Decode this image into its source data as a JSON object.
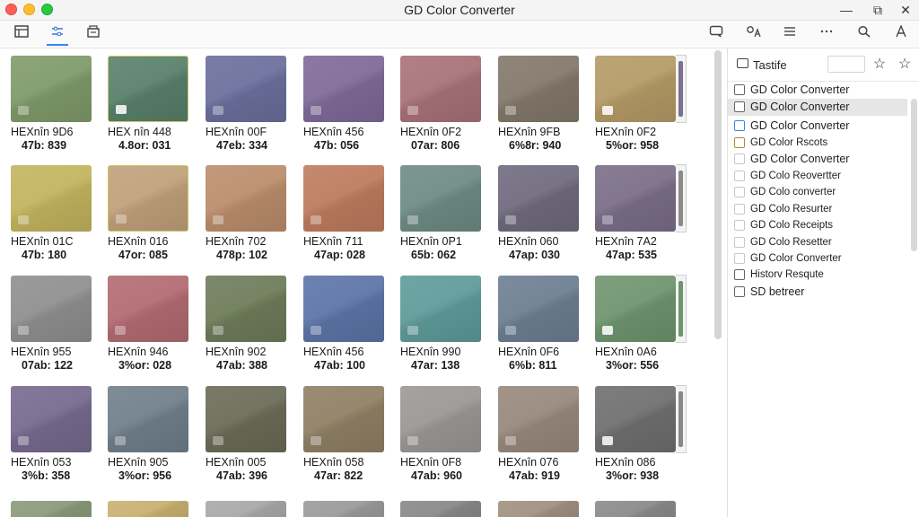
{
  "window": {
    "title": "GD Color Converter"
  },
  "toolbar": {
    "left_icons": [
      "panel-icon",
      "adjust-icon",
      "archive-icon"
    ],
    "right_icons": [
      "chat-icon",
      "translate-icon",
      "menu-icon",
      "more-icon",
      "search-icon",
      "font-icon"
    ]
  },
  "grid": {
    "tiles": [
      {
        "color": "#7f9a6a",
        "hex": "HEXnîn 9D6",
        "val": "47b: 839"
      },
      {
        "color": "#58806a",
        "hex": "HEX nîn 448",
        "val": "4.8or: 031",
        "selected": true,
        "mark": "bright"
      },
      {
        "color": "#6b6f9c",
        "hex": "HEXnîn 00F",
        "val": "47eb: 334"
      },
      {
        "color": "#7e6a98",
        "hex": "HEXnîn 456",
        "val": "47b: 056"
      },
      {
        "color": "#a87178",
        "hex": "HEXnîn 0F2",
        "val": "07ar: 806"
      },
      {
        "color": "#82786a",
        "hex": "HEXnîn 9FB",
        "val": "6%8r: 940"
      },
      {
        "color": "#b49a66",
        "hex": "HEXnîn 0F2",
        "val": "5%or: 958",
        "mark": "bright"
      },
      {
        "color": "#c2b45e",
        "hex": "HEXnîn 01C",
        "val": "47b: 180"
      },
      {
        "color": "#c0a07a",
        "hex": "HEXnîn 016",
        "val": "47or: 085",
        "selected": true
      },
      {
        "color": "#bb8d6c",
        "hex": "HEXnîn 702",
        "val": "478p: 102"
      },
      {
        "color": "#bd7b5e",
        "hex": "HEXnîn 711",
        "val": "47ap: 028"
      },
      {
        "color": "#6e8a84",
        "hex": "HEXnîn 0P1",
        "val": "65b: 062"
      },
      {
        "color": "#6f6a7e",
        "hex": "HEXnîn 060",
        "val": "47ap: 030"
      },
      {
        "color": "#7b6d88",
        "hex": "HEXnîn 7A2",
        "val": "47ap: 535"
      },
      {
        "color": "#8f8f8f",
        "hex": "HEXnîn 955",
        "val": "07ab: 122"
      },
      {
        "color": "#b26b72",
        "hex": "HEXnîn 946",
        "val": "3%or: 028"
      },
      {
        "color": "#6d7c5a",
        "hex": "HEXnîn 902",
        "val": "47ab: 388"
      },
      {
        "color": "#5d74a6",
        "hex": "HEXnîn 456",
        "val": "47ab: 100"
      },
      {
        "color": "#5f9a9a",
        "hex": "HEXnîn 990",
        "val": "47ar: 138"
      },
      {
        "color": "#6d7e92",
        "hex": "HEXnîn 0F6",
        "val": "6%b: 811"
      },
      {
        "color": "#6f946e",
        "hex": "HEXnîn 0A6",
        "val": "3%or: 556",
        "mark": "bright"
      },
      {
        "color": "#766a8e",
        "hex": "HEXnîn 053",
        "val": "3%b: 358"
      },
      {
        "color": "#6f7f8a",
        "hex": "HEXnîn 905",
        "val": "3%or: 956"
      },
      {
        "color": "#6b6b58",
        "hex": "HEXnîn 005",
        "val": "47ab: 396"
      },
      {
        "color": "#8f8064",
        "hex": "HEXnîn 058",
        "val": "47ar: 822"
      },
      {
        "color": "#9a9894",
        "hex": "HEXnîn 0F8",
        "val": "47ab: 960"
      },
      {
        "color": "#98887c",
        "hex": "HEXnîn 076",
        "val": "47ab: 919"
      },
      {
        "color": "#6f6f6f",
        "hex": "HEXnîn 086",
        "val": "3%or: 938",
        "mark": "bright"
      }
    ],
    "partial_row_colors": [
      "#8a9a7a",
      "#c8b070",
      "#a8a8a8",
      "#9a9a9a",
      "#888888",
      "#a09080",
      "#8a8a8a"
    ],
    "side_strip_colors": [
      "#7a7090",
      "#8a8a8a",
      "#6f946e",
      "#888888"
    ]
  },
  "panel": {
    "title": "Tastife",
    "items": [
      {
        "label": "GD Color Converter",
        "check": "normal"
      },
      {
        "label": "GD Color Converter",
        "check": "normal",
        "selected": true
      },
      {
        "label": "GD Color Converter",
        "check": "blue"
      },
      {
        "label": "GD Color Rscots",
        "check": "tan",
        "small": true
      },
      {
        "label": "GD Color Converter",
        "check": "light"
      },
      {
        "label": "GD Colo Reovertter",
        "check": "light",
        "small": true
      },
      {
        "label": "GD Colo converter",
        "check": "light",
        "small": true
      },
      {
        "label": "GD Colo Resurter",
        "check": "light",
        "small": true
      },
      {
        "label": "GD Colo Receipts",
        "check": "light",
        "small": true
      },
      {
        "label": "GD Colo Resetter",
        "check": "light",
        "small": true
      },
      {
        "label": "GD Color Converter",
        "check": "light",
        "small": true
      },
      {
        "label": "Historv Resqute",
        "check": "normal",
        "small": true
      },
      {
        "label": "SD betreer",
        "check": "normal"
      }
    ]
  }
}
